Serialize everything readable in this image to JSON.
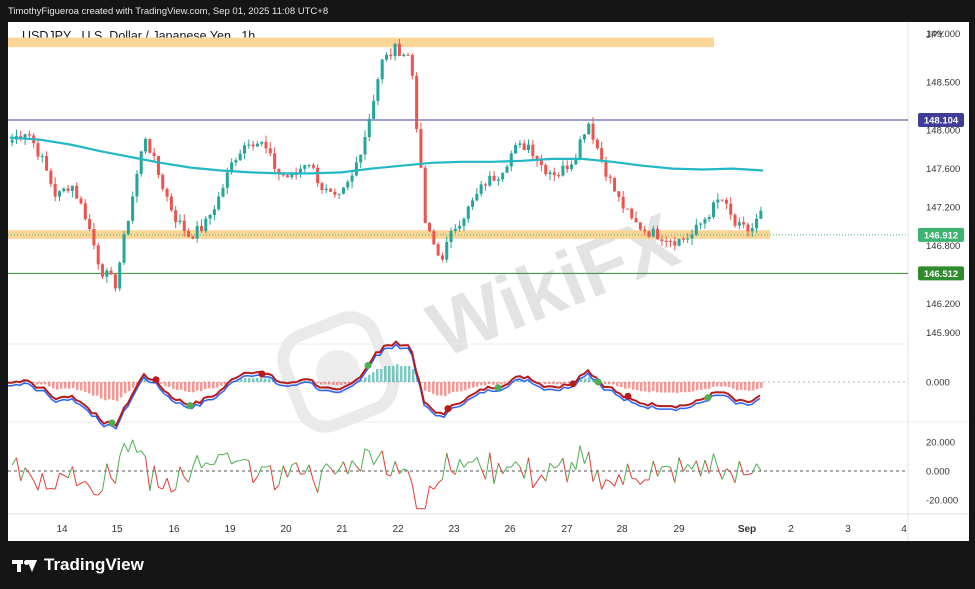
{
  "header": {
    "credit": "TimothyFigueroa created with TradingView.com, Sep 01, 2025 11:08 UTC+8"
  },
  "footer": {
    "brand": "TradingView"
  },
  "watermark": {
    "text": "WikiFX"
  },
  "chart_data": {
    "type": "candlestick",
    "title": "USDJPY . U.S. Dollar / Japanese Yen . 1h",
    "currency": "JPY",
    "price_axis_ticks": [
      "149.000",
      "148.500",
      "148.000",
      "147.600",
      "147.200",
      "146.800",
      "146.200",
      "145.900"
    ],
    "price_tick_values": [
      149.0,
      148.5,
      148.0,
      147.6,
      147.2,
      146.8,
      146.2,
      145.9
    ],
    "ylim": [
      145.82,
      149.08
    ],
    "x_axis_labels": [
      "14",
      "15",
      "16",
      "19",
      "20",
      "21",
      "22",
      "23",
      "26",
      "27",
      "28",
      "29",
      "Sep",
      "2",
      "3",
      "4"
    ],
    "lines": [
      {
        "label": "148.104",
        "value": 148.104,
        "color": "#3f3d99"
      },
      {
        "label": "146.912",
        "value": 146.912,
        "color": "#3cb371"
      },
      {
        "label": "146.512",
        "value": 146.512,
        "color": "#2e8b2e"
      }
    ],
    "zones": [
      {
        "from": 148.86,
        "to": 148.96,
        "color": "#fcd697"
      },
      {
        "from": 146.87,
        "to": 146.96,
        "color": "#fcd697"
      }
    ],
    "ma": {
      "color": "#22b8c4",
      "values": [
        147.92,
        147.9,
        147.85,
        147.78,
        147.72,
        147.66,
        147.61,
        147.58,
        147.56,
        147.55,
        147.55,
        147.56,
        147.6,
        147.63,
        147.66,
        147.67,
        147.67,
        147.68,
        147.7,
        147.7,
        147.67,
        147.63,
        147.6,
        147.59,
        147.6,
        147.58
      ]
    },
    "price_path": [
      147.9,
      148.0,
      147.7,
      147.3,
      147.45,
      147.1,
      146.55,
      146.4,
      147.2,
      147.95,
      147.5,
      147.1,
      146.9,
      147.0,
      147.3,
      147.7,
      147.9,
      147.85,
      147.55,
      147.5,
      147.7,
      147.4,
      147.25,
      147.5,
      148.0,
      148.7,
      148.85,
      148.75,
      147.0,
      146.65,
      147.0,
      147.2,
      147.45,
      147.55,
      147.8,
      147.85,
      147.6,
      147.55,
      147.7,
      148.1,
      147.65,
      147.3,
      147.05,
      146.95,
      146.9,
      146.85,
      146.9,
      147.1,
      147.3,
      147.0,
      146.95,
      147.2
    ]
  }
}
